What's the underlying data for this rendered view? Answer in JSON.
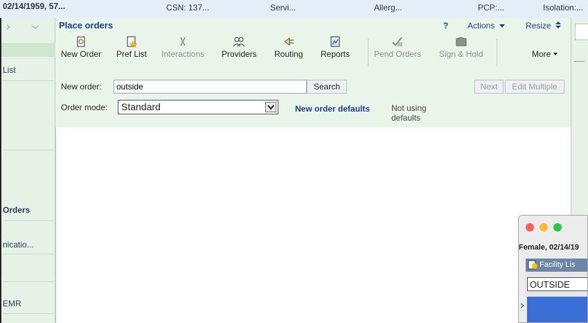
{
  "topbar": {
    "dob": "02/14/1959, 57...",
    "csn": "CSN: 137...",
    "serv": "Servi...",
    "allergy": "Allerg...",
    "pcp": "PCP:...",
    "isolation": "Isolation:..."
  },
  "sidebar": {
    "items": [
      {
        "label": "List"
      },
      {
        "label": "Orders"
      },
      {
        "label": "nicatio..."
      },
      {
        "label": "EMR"
      }
    ]
  },
  "panel": {
    "title": "Place orders",
    "help": "?",
    "actions_label": "Actions",
    "resize_label": "Resize"
  },
  "toolbar": {
    "new_order": "New Order",
    "pref_list": "Pref List",
    "interactions": "Interactions",
    "providers": "Providers",
    "routing": "Routing",
    "reports": "Reports",
    "pend_orders": "Pend Orders",
    "sign_hold": "Sign & Hold",
    "more": "More"
  },
  "form": {
    "new_order_label": "New order:",
    "new_order_value": "outside",
    "search_label": "Search",
    "next_label": "Next",
    "edit_multiple_label": "Edit Multiple",
    "order_mode_label": "Order mode:",
    "order_mode_value": "Standard",
    "defaults_link": "New order defaults",
    "defaults_status": "Not using defaults"
  },
  "popup": {
    "patient": "Female, 02/14/19",
    "title": "Facility Lis",
    "input_value": "OUTSIDE"
  },
  "colors": {
    "accent": "#1a3e8c",
    "panel_bg": "#eaf5ea",
    "popup_selection": "#3a6fd8"
  }
}
